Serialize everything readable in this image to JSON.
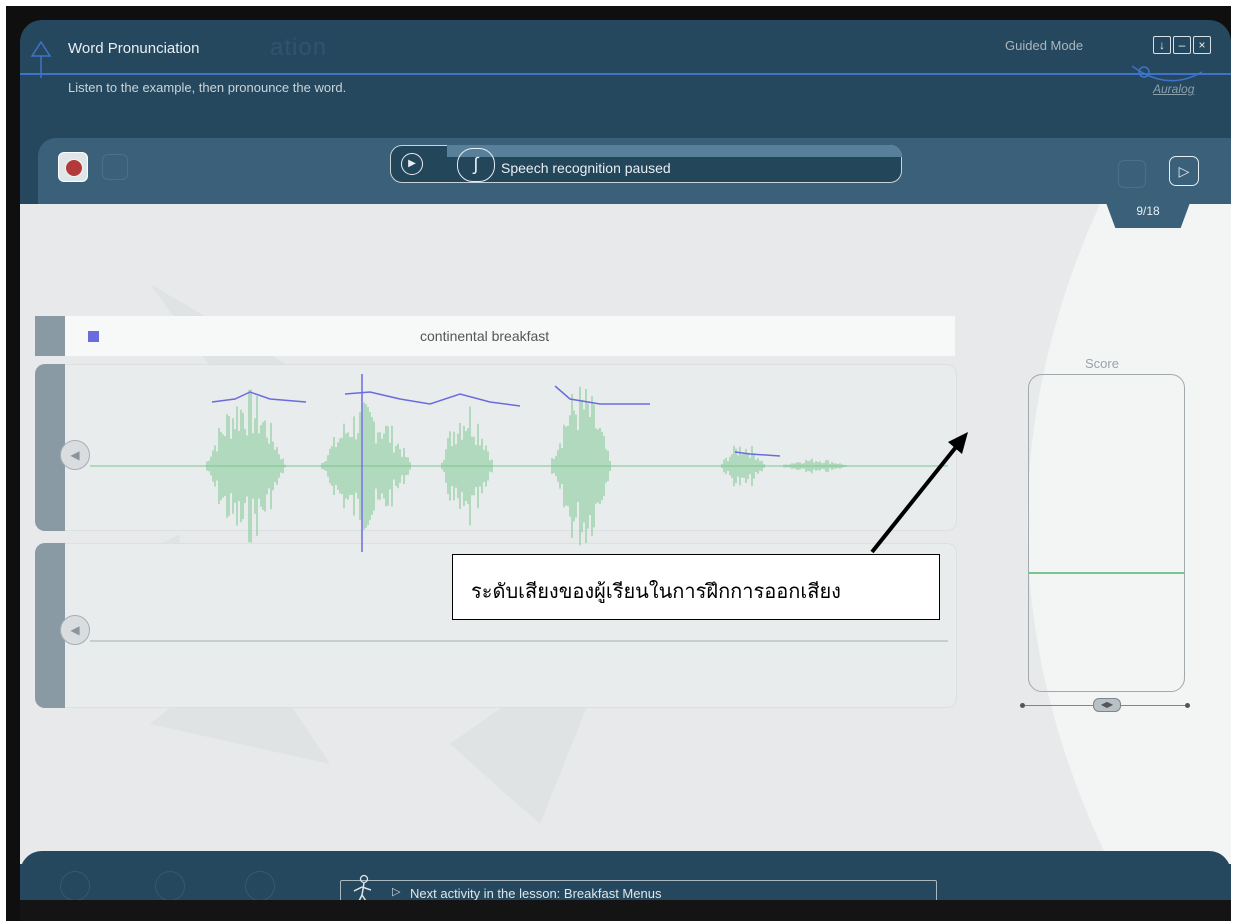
{
  "header": {
    "title": "Word Pronunciation",
    "title_ghost": "ation",
    "subtitle": "Listen to the example, then pronounce the word.",
    "mode": "Guided Mode",
    "logo": "Auralog"
  },
  "toolbar": {
    "speech_status": "Speech recognition paused",
    "page_counter": "9/18"
  },
  "exercise": {
    "word": "continental breakfast",
    "score_label": "Score"
  },
  "annotation": {
    "text": "ระดับเสียงของผู้เรียนในการฝึกการออกเสียง"
  },
  "footer": {
    "next_activity": "Next activity in the lesson: Breakfast Menus"
  },
  "colors": {
    "app_bg": "#25485e",
    "accent_line": "#3f73c9",
    "waveform": "#78c68f",
    "pitch": "#6b6be0"
  }
}
